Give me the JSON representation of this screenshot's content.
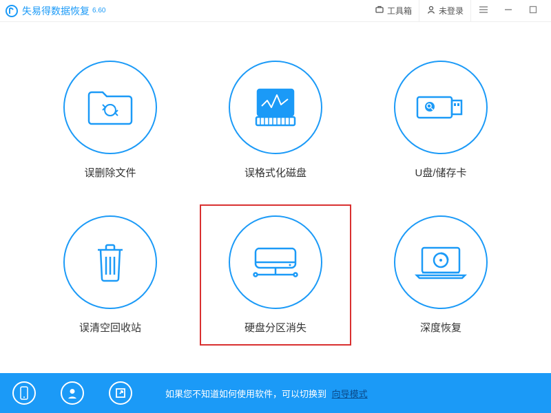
{
  "app": {
    "title": "失易得数据恢复",
    "version": "6.60"
  },
  "titlebar": {
    "toolbox": "工具箱",
    "login": "未登录"
  },
  "options": [
    {
      "label": "误删除文件"
    },
    {
      "label": "误格式化磁盘"
    },
    {
      "label": "U盘/储存卡"
    },
    {
      "label": "误清空回收站"
    },
    {
      "label": "硬盘分区消失"
    },
    {
      "label": "深度恢复"
    }
  ],
  "footer": {
    "hint": "如果您不知道如何使用软件，可以切换到",
    "wizard_link": "向导模式"
  }
}
